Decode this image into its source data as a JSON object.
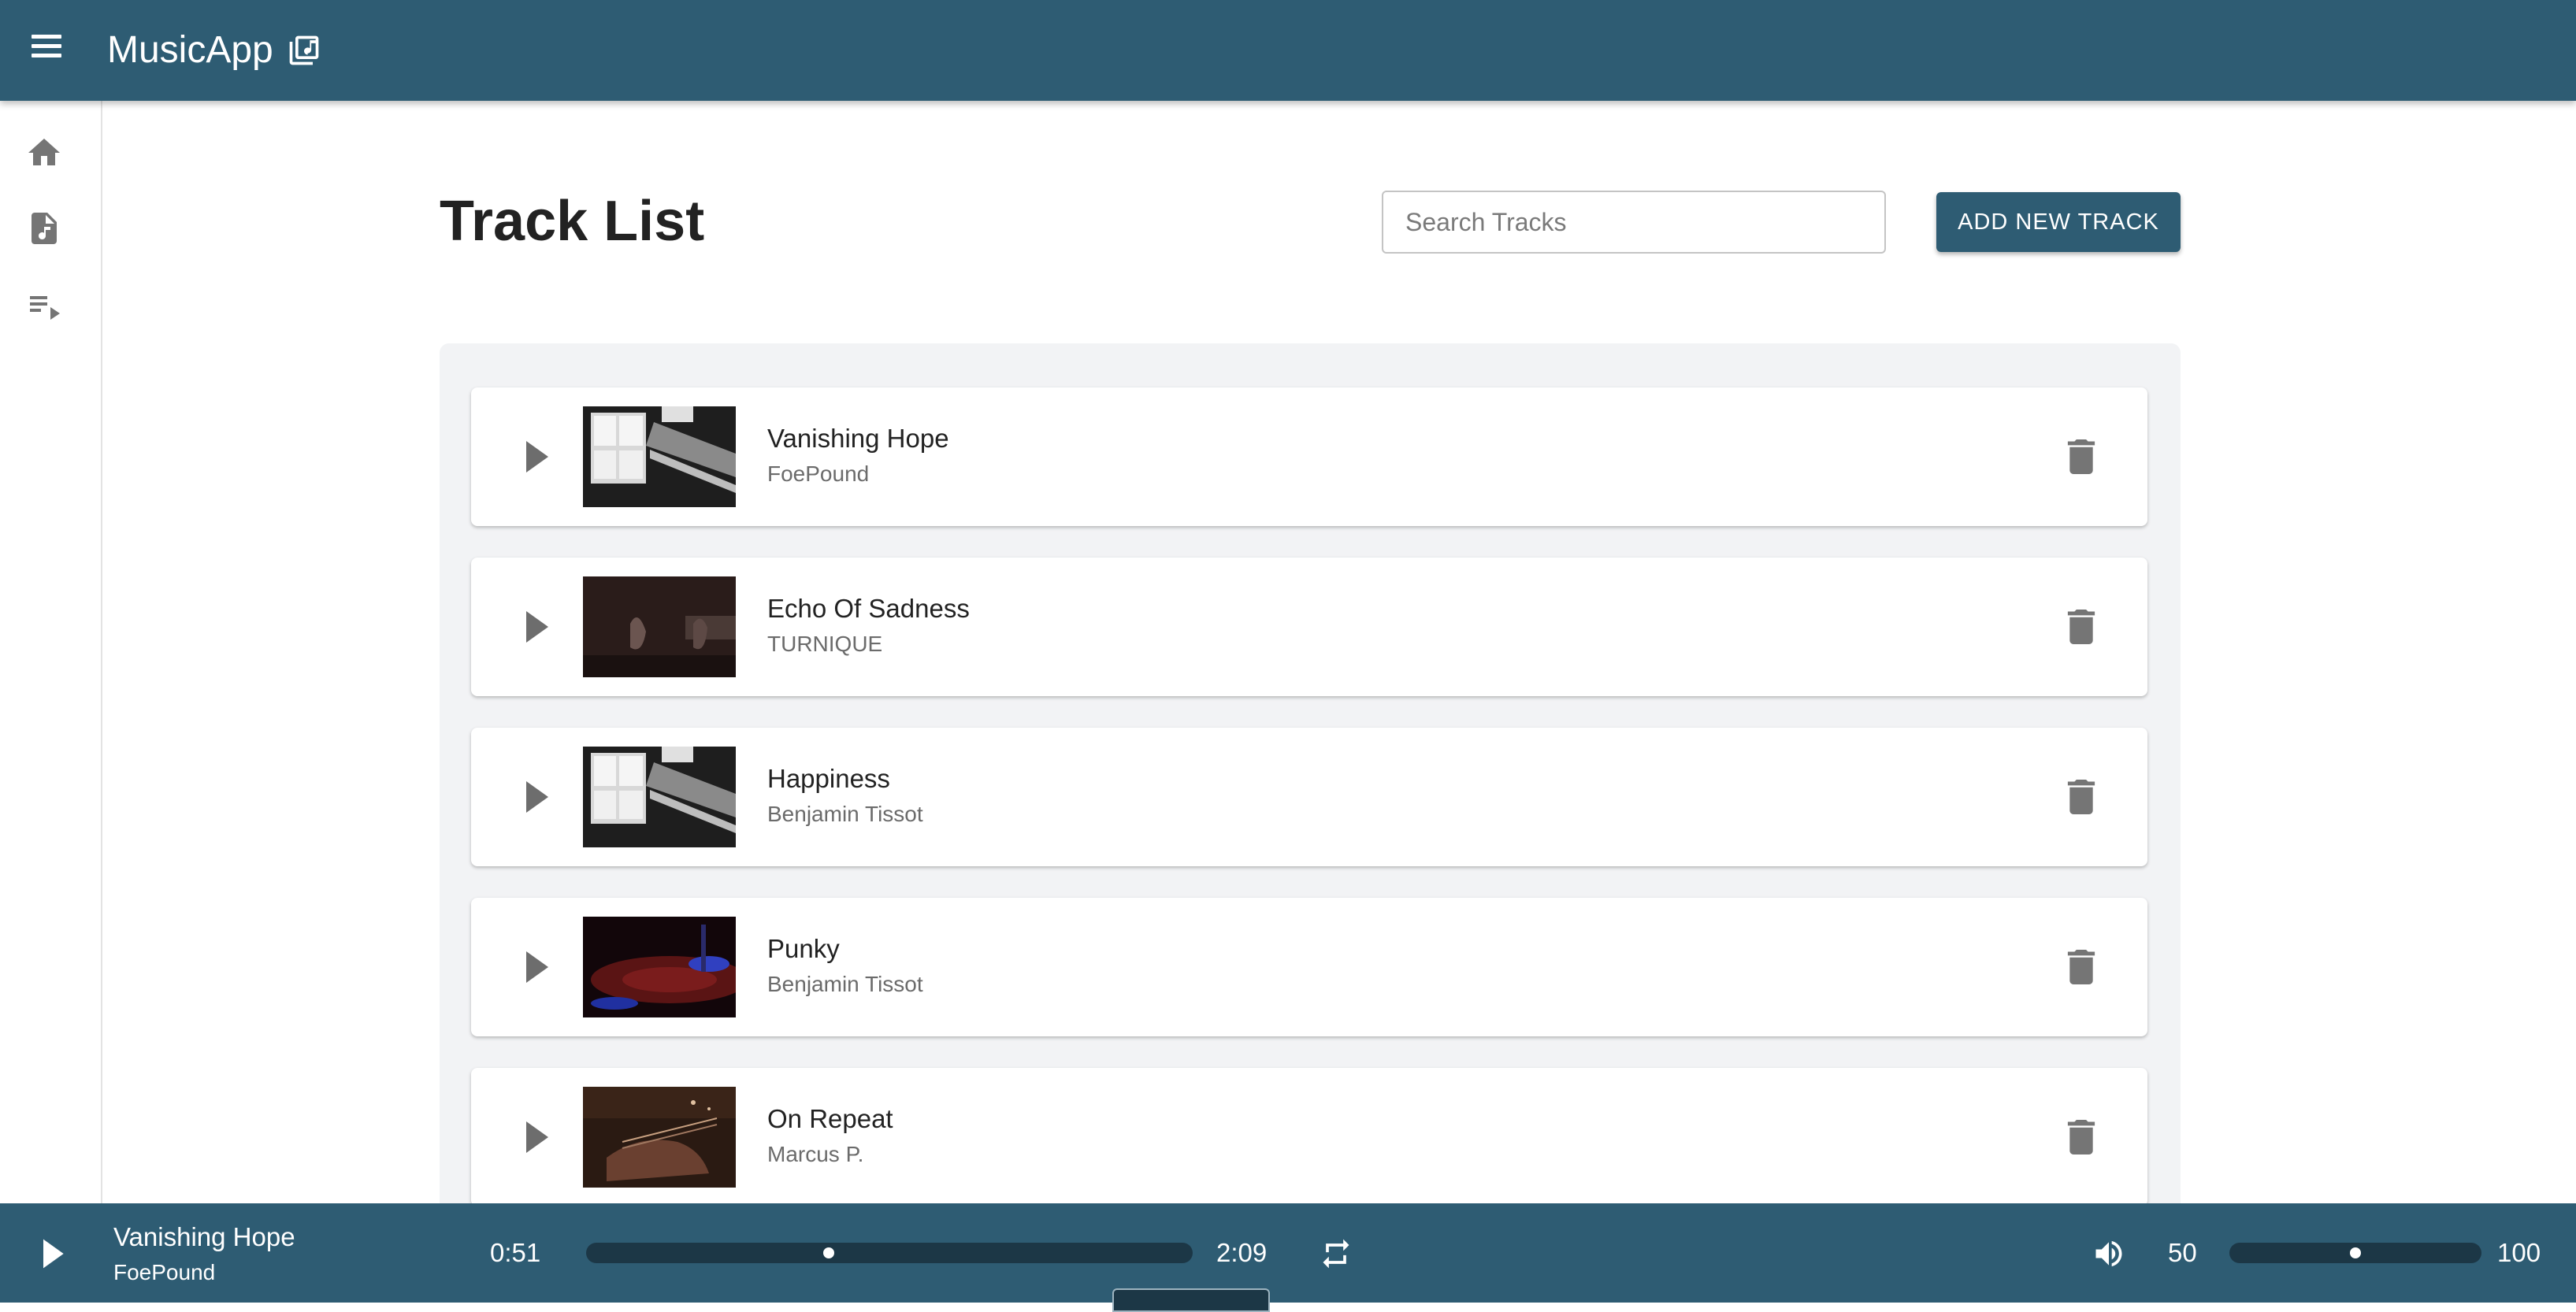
{
  "app": {
    "title": "MusicApp"
  },
  "sidebar": {
    "items": [
      {
        "icon": "home-icon"
      },
      {
        "icon": "music-file-icon"
      },
      {
        "icon": "playlist-icon"
      }
    ]
  },
  "main": {
    "title": "Track List",
    "search": {
      "placeholder": "Search Tracks",
      "value": ""
    },
    "add_button": "ADD NEW TRACK"
  },
  "tracks": [
    {
      "title": "Vanishing Hope",
      "artist": "FoePound",
      "thumb": "piano-window-bw"
    },
    {
      "title": "Echo Of Sadness",
      "artist": "TURNIQUE",
      "thumb": "piano-hands-dark"
    },
    {
      "title": "Happiness",
      "artist": "Benjamin Tissot",
      "thumb": "piano-window-bw"
    },
    {
      "title": "Punky",
      "artist": "Benjamin Tissot",
      "thumb": "cymbal-red-blue"
    },
    {
      "title": "On Repeat",
      "artist": "Marcus P.",
      "thumb": "guitar-brown"
    }
  ],
  "player": {
    "title": "Vanishing Hope",
    "artist": "FoePound",
    "elapsed": "0:51",
    "duration": "2:09",
    "progress_fraction": 0.4,
    "volume": "50",
    "volume_max": "100",
    "volume_fraction": 0.5
  },
  "colors": {
    "primary": "#2e5c73",
    "track_dark": "#1c3746"
  }
}
